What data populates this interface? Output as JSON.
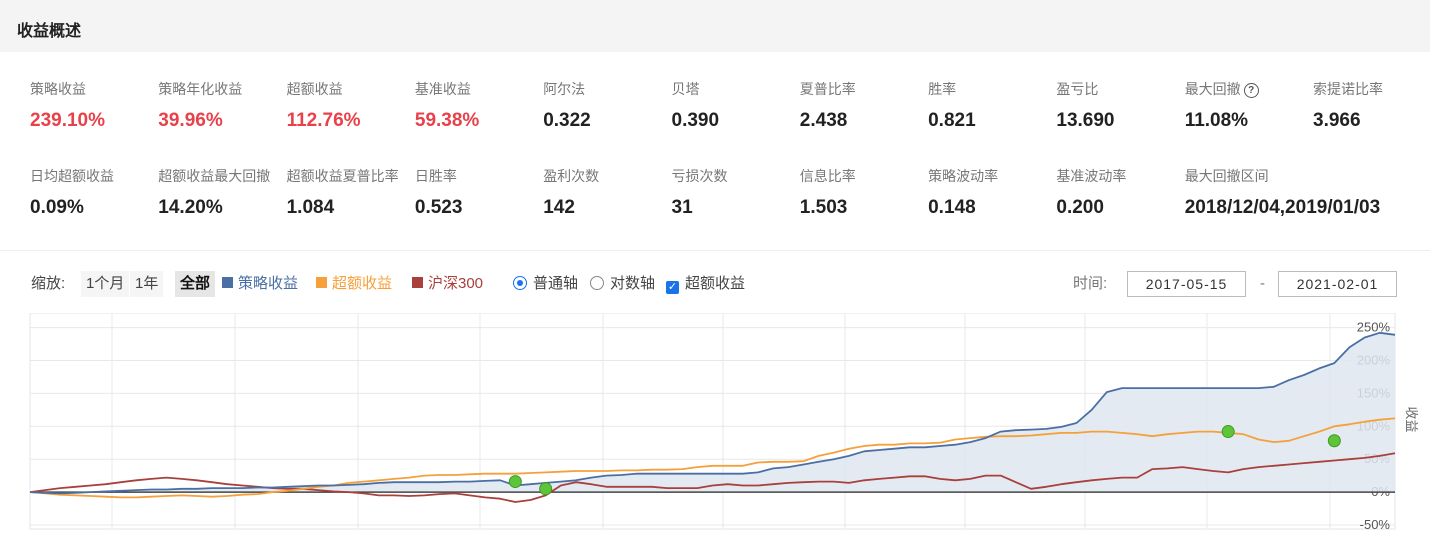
{
  "section_title": "收益概述",
  "metrics_row1": [
    {
      "label": "策略收益",
      "value": "239.10%",
      "highlight": true
    },
    {
      "label": "策略年化收益",
      "value": "39.96%",
      "highlight": true
    },
    {
      "label": "超额收益",
      "value": "112.76%",
      "highlight": true
    },
    {
      "label": "基准收益",
      "value": "59.38%",
      "highlight": true
    },
    {
      "label": "阿尔法",
      "value": "0.322",
      "highlight": false
    },
    {
      "label": "贝塔",
      "value": "0.390",
      "highlight": false
    },
    {
      "label": "夏普比率",
      "value": "2.438",
      "highlight": false
    },
    {
      "label": "胜率",
      "value": "0.821",
      "highlight": false
    },
    {
      "label": "盈亏比",
      "value": "13.690",
      "highlight": false
    },
    {
      "label": "最大回撤",
      "value": "11.08%",
      "highlight": false,
      "help_icon": "?"
    },
    {
      "label": "索提诺比率",
      "value": "3.966",
      "highlight": false
    }
  ],
  "metrics_row2": [
    {
      "label": "日均超额收益",
      "value": "0.09%"
    },
    {
      "label": "超额收益最大回撤",
      "value": "14.20%"
    },
    {
      "label": "超额收益夏普比率",
      "value": "1.084"
    },
    {
      "label": "日胜率",
      "value": "0.523"
    },
    {
      "label": "盈利次数",
      "value": "142"
    },
    {
      "label": "亏损次数",
      "value": "31"
    },
    {
      "label": "信息比率",
      "value": "1.503"
    },
    {
      "label": "策略波动率",
      "value": "0.148"
    },
    {
      "label": "基准波动率",
      "value": "0.200"
    },
    {
      "label": "最大回撤区间",
      "value": "2018/12/04,2019/01/03"
    }
  ],
  "toolbar": {
    "zoom_label": "缩放:",
    "zoom_options": [
      "1个月",
      "1年",
      "全部"
    ],
    "zoom_selected": "全部",
    "legend": [
      {
        "label": "策略收益",
        "color": "#4a6fa5"
      },
      {
        "label": "超额收益",
        "color": "#f5a03a"
      },
      {
        "label": "沪深300",
        "color": "#a8403c"
      }
    ],
    "axis_options": [
      {
        "label": "普通轴",
        "selected": true
      },
      {
        "label": "对数轴",
        "selected": false
      }
    ],
    "excess_checkbox": {
      "label": "超额收益",
      "checked": true
    },
    "time_label": "时间:",
    "date_from": "2017-05-15",
    "date_sep": "-",
    "date_to": "2021-02-01"
  },
  "chart_data": {
    "type": "line",
    "ylabel": "收益",
    "yticks": [
      "250%",
      "200%",
      "150%",
      "100%",
      "50%",
      "0%",
      "-50%"
    ],
    "ylim": [
      -50,
      260
    ],
    "x_range": [
      "2017-05-15",
      "2021-02-01"
    ],
    "series": [
      {
        "name": "策略收益",
        "color": "#4a6fa5",
        "fill": true,
        "values": [
          0,
          -1,
          -2,
          -1,
          0,
          1,
          2,
          3,
          4,
          4,
          5,
          5,
          6,
          6,
          6,
          7,
          7,
          8,
          9,
          10,
          10,
          11,
          12,
          14,
          15,
          15,
          15,
          15,
          16,
          16,
          17,
          18,
          10,
          12,
          14,
          16,
          18,
          22,
          25,
          26,
          28,
          28,
          28,
          28,
          28,
          28,
          28,
          28,
          30,
          36,
          38,
          42,
          46,
          50,
          55,
          62,
          64,
          66,
          68,
          68,
          70,
          72,
          76,
          82,
          92,
          94,
          95,
          96,
          99,
          105,
          125,
          152,
          158,
          158,
          158,
          158,
          158,
          158,
          158,
          158,
          158,
          158,
          160,
          170,
          178,
          188,
          196,
          220,
          235,
          242,
          239
        ]
      },
      {
        "name": "超额收益",
        "color": "#f5a03a",
        "fill": false,
        "values": [
          0,
          -2,
          -4,
          -5,
          -6,
          -7,
          -8,
          -8,
          -7,
          -6,
          -5,
          -6,
          -7,
          -6,
          -4,
          -3,
          0,
          2,
          5,
          8,
          10,
          14,
          16,
          18,
          20,
          22,
          25,
          26,
          26,
          27,
          28,
          28,
          28,
          29,
          30,
          31,
          32,
          32,
          32,
          33,
          33,
          34,
          34,
          35,
          38,
          40,
          40,
          40,
          45,
          46,
          46,
          47,
          55,
          60,
          66,
          70,
          72,
          72,
          74,
          74,
          75,
          80,
          82,
          84,
          85,
          85,
          86,
          88,
          90,
          90,
          92,
          92,
          90,
          88,
          85,
          88,
          90,
          92,
          92,
          90,
          88,
          80,
          76,
          78,
          85,
          92,
          100,
          103,
          107,
          110,
          112
        ]
      },
      {
        "name": "沪深300",
        "color": "#a8403c",
        "fill": false,
        "values": [
          0,
          3,
          6,
          8,
          10,
          12,
          15,
          18,
          20,
          22,
          20,
          18,
          15,
          12,
          10,
          8,
          6,
          5,
          5,
          3,
          1,
          0,
          -2,
          -5,
          -5,
          -6,
          -5,
          -3,
          -2,
          -5,
          -8,
          -10,
          -15,
          -12,
          -5,
          10,
          15,
          12,
          8,
          8,
          8,
          8,
          6,
          6,
          6,
          10,
          12,
          10,
          10,
          12,
          14,
          15,
          16,
          16,
          14,
          18,
          20,
          22,
          24,
          24,
          20,
          18,
          20,
          25,
          25,
          15,
          5,
          8,
          12,
          15,
          18,
          20,
          22,
          22,
          35,
          36,
          38,
          35,
          32,
          30,
          35,
          38,
          40,
          42,
          44,
          46,
          48,
          50,
          52,
          55,
          59
        ]
      }
    ],
    "markers": [
      {
        "index": 32,
        "value": 16
      },
      {
        "index": 34,
        "value": 5
      },
      {
        "index": 79,
        "value": 92
      },
      {
        "index": 86,
        "value": 78
      }
    ]
  }
}
